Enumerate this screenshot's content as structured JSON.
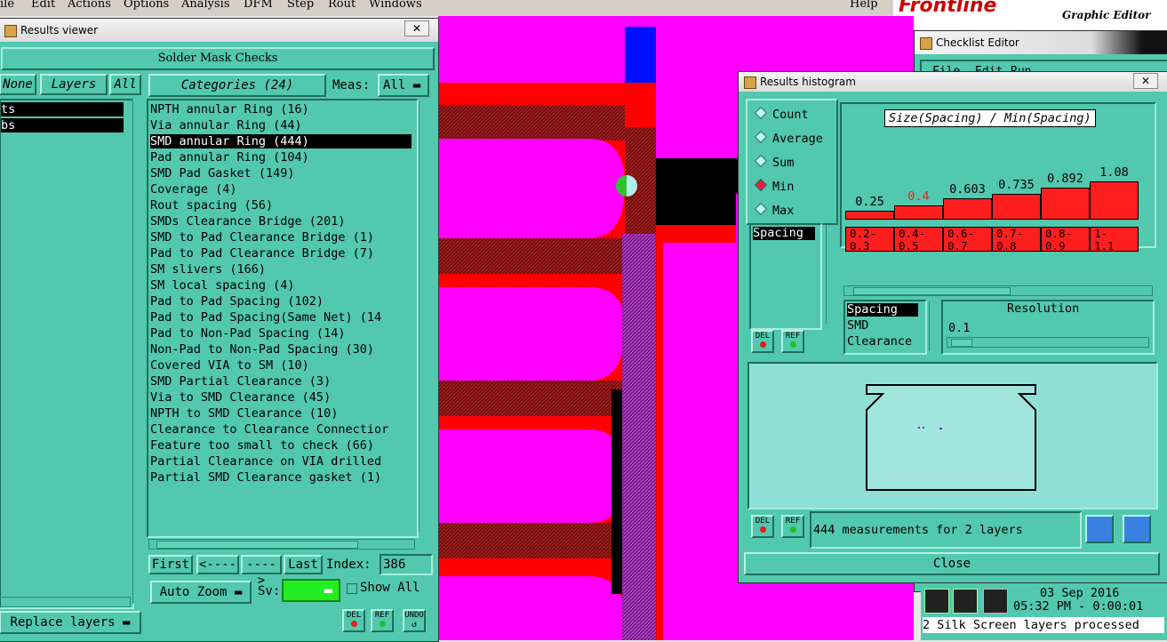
{
  "menubar": {
    "items": [
      "ile",
      "Edit",
      "Actions",
      "Options",
      "Analysis",
      "DFM",
      "Step",
      "Rout",
      "Windows"
    ],
    "help": "Help",
    "brand": "Frontline",
    "brand_sub": "Graphic Editor"
  },
  "results_viewer": {
    "title": "Results viewer",
    "close": "✕",
    "panel_title": "Solder Mask Checks",
    "none_label": "None",
    "layers_label": "Layers",
    "all_label": "All",
    "layers": [
      "ts",
      "bs"
    ],
    "categories_label": "Categories (24)",
    "meas_label": "Meas:",
    "meas_value": "All",
    "categories": [
      "NPTH annular Ring (16)",
      "Via annular Ring (44)",
      "SMD annular Ring (444)",
      "Pad annular Ring (104)",
      "SMD Pad Gasket (149)",
      "Coverage (4)",
      "Rout spacing (56)",
      "SMDs Clearance Bridge (201)",
      "SMD to Pad Clearance Bridge (1)",
      "Pad to Pad Clearance Bridge (7)",
      "SM slivers (166)",
      "SM local spacing (4)",
      "Pad to Pad Spacing (102)",
      "Pad to Pad Spacing(Same Net) (14",
      "Pad to Non-Pad Spacing (14)",
      "Non-Pad to Non-Pad Spacing (30)",
      "Covered VIA to SM (10)",
      "SMD Partial Clearance (3)",
      "Via to SMD Clearance (45)",
      "NPTH to SMD Clearance (10)",
      "Clearance to Clearance Connectior",
      "Feature too small to check (66)",
      "Partial Clearance on VIA drilled",
      "Partial SMD Clearance gasket (1)"
    ],
    "selected_category": "SMD annular Ring (444)",
    "nav": {
      "first": "First",
      "prev": "<----",
      "next": "---->",
      "last": "Last",
      "index_label": "Index:",
      "index_value": "386"
    },
    "auto_zoom": "Auto Zoom",
    "sv_label": "Sv:",
    "show_all": "Show All",
    "replace_layers": "Replace layers",
    "del": "DEL",
    "ref": "REF",
    "undo": "UNDO"
  },
  "histogram": {
    "title": "Results histogram",
    "close": "✕",
    "modes": [
      "Count",
      "Average",
      "Sum",
      "Min",
      "Max"
    ],
    "selected_mode": "Min",
    "chart_title": "Size(Spacing) / Min(Spacing)",
    "measure_list": [
      "Spacing"
    ],
    "types": [
      "Spacing",
      "SMD",
      "Clearance"
    ],
    "resolution_label": "Resolution",
    "resolution_value": "0.1",
    "status": "444 measurements for 2 layers",
    "close_button": "Close",
    "del": "DEL",
    "ref": "REF"
  },
  "chart_data": {
    "type": "bar",
    "title": "Size(Spacing) / Min(Spacing)",
    "categories": [
      "0.2-\n0.3",
      "0.4-\n0.5",
      "0.6-\n0.7",
      "0.7-\n0.8",
      "0.8-\n0.9",
      "1-\n1.1"
    ],
    "values": [
      0.25,
      0.4,
      0.603,
      0.735,
      0.892,
      1.08
    ],
    "value_labels": [
      "0.25",
      "0.4",
      "0.603",
      "0.735",
      "0.892",
      "1.08"
    ],
    "highlight_index": 1,
    "ylim": [
      0,
      1.1
    ],
    "bar_color": "#ff1e1e"
  },
  "checklist": {
    "title": "Checklist Editor",
    "menu": [
      "File",
      "Edit",
      "Run"
    ]
  },
  "status_area": {
    "date": "03 Sep 2016",
    "time": "05:32 PM - 0:00:01",
    "message": "2 Silk Screen layers processed"
  },
  "colors": {
    "panel": "#52c8ae",
    "canvas": "#ff00ff",
    "accent_red": "#ff1e1e",
    "selection": "#000000"
  }
}
